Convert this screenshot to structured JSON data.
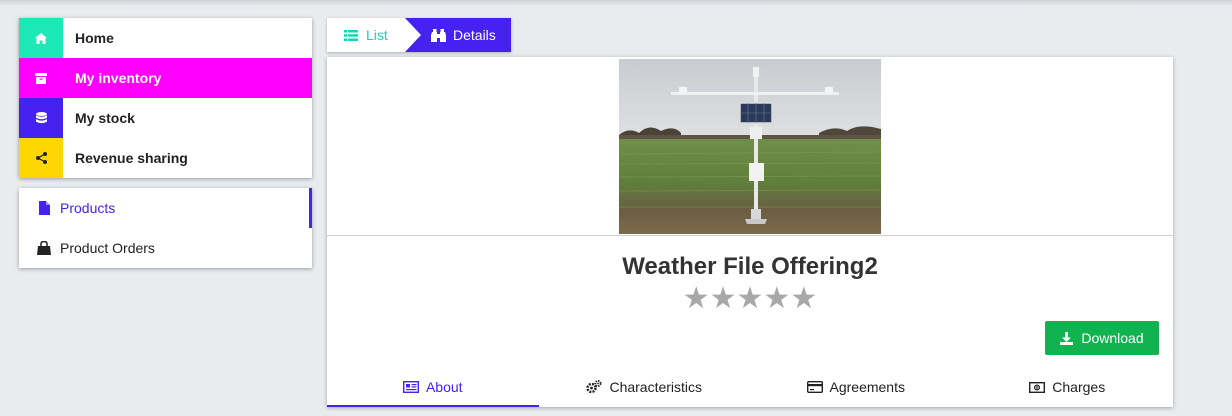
{
  "menu": {
    "items": [
      {
        "label": "Home",
        "icon": "home-icon",
        "color": "#1de9b6"
      },
      {
        "label": "My inventory",
        "icon": "archive-icon",
        "color": "#ff00ff"
      },
      {
        "label": "My stock",
        "icon": "database-icon",
        "color": "#4622f0"
      },
      {
        "label": "Revenue sharing",
        "icon": "share-icon",
        "color": "#ffd600"
      }
    ],
    "active": "My inventory"
  },
  "submenu": {
    "items": [
      {
        "label": "Products",
        "icon": "file-icon"
      },
      {
        "label": "Product Orders",
        "icon": "shopping-bag-icon"
      }
    ],
    "active": "Products"
  },
  "breadcrumb": {
    "list_label": "List",
    "details_label": "Details"
  },
  "product": {
    "title": "Weather File Offering2",
    "rating_stars": 5,
    "rating_value": 0,
    "stars_text": "★★★★★",
    "download_label": "Download"
  },
  "tabs": [
    {
      "label": "About",
      "icon": "newspaper-icon"
    },
    {
      "label": "Characteristics",
      "icon": "gears-icon"
    },
    {
      "label": "Agreements",
      "icon": "credit-card-icon"
    },
    {
      "label": "Charges",
      "icon": "money-icon"
    }
  ],
  "active_tab": "About",
  "colors": {
    "accent": "#4622f0",
    "teal": "#1de9b6",
    "magenta": "#ff00ff",
    "yellow": "#ffd600",
    "download_green": "#10b350",
    "star_gray": "#a8a8a8"
  }
}
